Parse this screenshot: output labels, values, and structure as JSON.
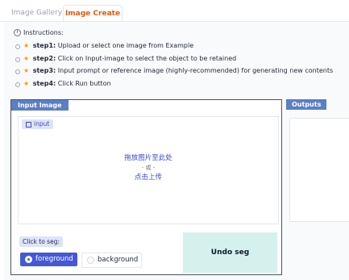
{
  "tabs": [
    {
      "label": "Image Gallery",
      "active": false
    },
    {
      "label": "Image Create",
      "active": true
    }
  ],
  "instructions": {
    "title": "Instructions:",
    "steps": [
      {
        "name": "step1:",
        "text": "Upload or select one image from Example"
      },
      {
        "name": "step2:",
        "text": "Click on Input-image to select the object to be retained"
      },
      {
        "name": "step3:",
        "text": "Input prompt or reference image (highly-recommended) for generating new contents"
      },
      {
        "name": "step4:",
        "text": "Click Run button"
      }
    ]
  },
  "input_image": {
    "label": "Input Image",
    "chip": "input",
    "drop_line1": "拖放图片至此处",
    "drop_or": "- 或 -",
    "drop_line2": "点击上传"
  },
  "segmentation": {
    "label": "Click to seg:",
    "options": [
      "foreground",
      "background"
    ],
    "selected": "foreground",
    "undo_label": "Undo seg"
  },
  "outputs": {
    "label": "Outputs"
  },
  "colors": {
    "accent": "#ea580c",
    "block_label": "#5b7fc7",
    "selected_option": "#4558d6",
    "undo_bg": "#d5f1ed",
    "star": "#f59e0b"
  }
}
